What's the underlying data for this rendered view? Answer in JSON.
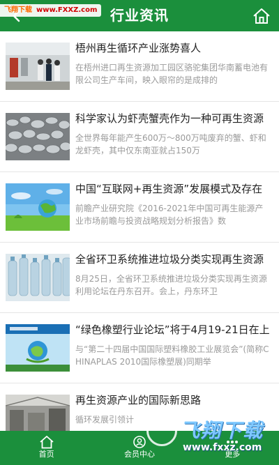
{
  "watermark_top": {
    "text": "飞翔下载",
    "url": "www.FXXZ.com"
  },
  "header": {
    "title": "行业资讯",
    "back_icon": "back-arrow-icon",
    "home_icon": "home-icon"
  },
  "articles": [
    {
      "title": "梧州再生循环产业涨势喜人",
      "summary": "在梧州进口再生资源加工园区骆驼集团华南蓄电池有限公司生产车间，映入眼帘的是成排的",
      "thumb": "factory-workers"
    },
    {
      "title": "科学家认为虾壳蟹壳作为一种可再生资源",
      "summary": "全世界每年能产生600万～800万吨废弃的蟹、虾和龙虾壳，其中仅东南亚就占150万",
      "thumb": "shells-pile"
    },
    {
      "title": "中国“互联网+再生资源”发展模式及存在",
      "summary": "前瞻产业研究院《2016-2021年中国可再生能源产业市场前瞻与投资战略规划分析报告》数",
      "thumb": "green-earth"
    },
    {
      "title": "全省环卫系统推进垃圾分类实现再生资源",
      "summary": "8月25日，全省环卫系统推进垃圾分类实现再生资源利用论坛在丹东召开。会上，丹东环卫",
      "thumb": "plastic-bottles"
    },
    {
      "title": "“绿色橡塑行业论坛”将于4月19-21日在上",
      "summary": "与“第二十四届中国国际塑料橡胶工业展览会”(简称CHINAPLAS 2010国际橡塑展)同期举",
      "thumb": "green-globe-banner"
    },
    {
      "title": "再生资源产业的国际新思路",
      "summary": "循环发展引领计",
      "thumb": "warehouse"
    }
  ],
  "bottom_nav": [
    {
      "label": "首页",
      "icon": "home-icon"
    },
    {
      "label": "会员中心",
      "icon": "user-icon"
    },
    {
      "label": "更多",
      "icon": "more-icon"
    }
  ],
  "watermark_bottom": {
    "text": "飞翔下载",
    "url": "www.fxxz.com"
  },
  "colors": {
    "primary": "#1b8f3c",
    "title_text": "#222222",
    "summary_text": "#9a9a9a"
  }
}
